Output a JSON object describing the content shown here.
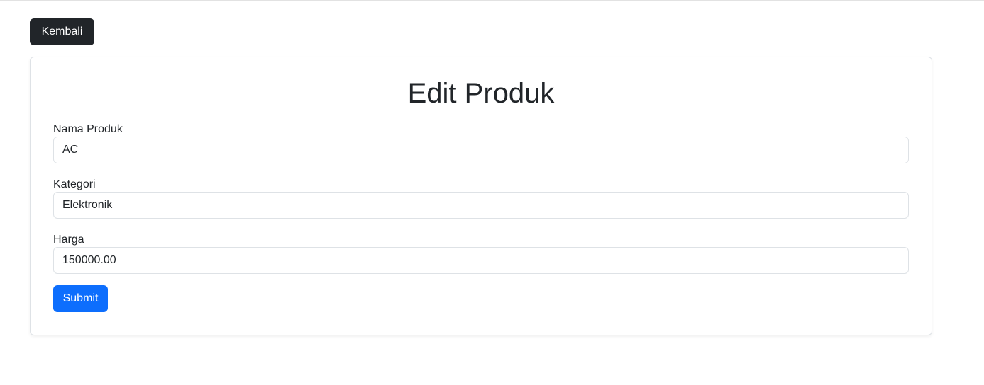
{
  "header": {
    "back_label": "Kembali"
  },
  "form": {
    "title": "Edit Produk",
    "fields": [
      {
        "label": "Nama Produk",
        "value": "AC"
      },
      {
        "label": "Kategori",
        "value": "Elektronik"
      },
      {
        "label": "Harga",
        "value": "150000.00"
      }
    ],
    "submit_label": "Submit"
  },
  "colors": {
    "back_button": "#212529",
    "submit_button": "#0d6efd",
    "border": "#dee2e6",
    "text": "#212529"
  }
}
